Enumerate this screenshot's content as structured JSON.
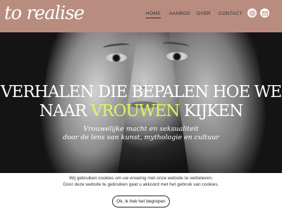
{
  "header": {
    "logo": "to realise",
    "nav": [
      {
        "label": "HOME",
        "active": true
      },
      {
        "label": "AANBOD",
        "active": false
      },
      {
        "label": "OVER",
        "active": false
      },
      {
        "label": "CONTACT",
        "active": false
      }
    ],
    "icons": [
      "instagram-icon",
      "mail-icon"
    ],
    "background_color": "#b98c80"
  },
  "hero": {
    "headline_line1": "VERHALEN DIE BEPALEN HOE WE",
    "headline_line2_before": "NAAR ",
    "headline_line2_accent": "VROUWEN",
    "headline_line2_after": " KIJKEN",
    "subtitle_line1": "Vrouwelijke macht en seksualiteit",
    "subtitle_line2": "door de lens van kunst, mythologie en cultuur",
    "accent_color": "#e3f25a"
  },
  "cookie_banner": {
    "line1": "Wij gebruiken cookies om uw ervaring met onze website te verbeteren.",
    "line2": "Door deze website te gebruiken geat u akkoord met het gebruik van cookies.",
    "button_label": "Ok, ik heb het begrepen"
  }
}
